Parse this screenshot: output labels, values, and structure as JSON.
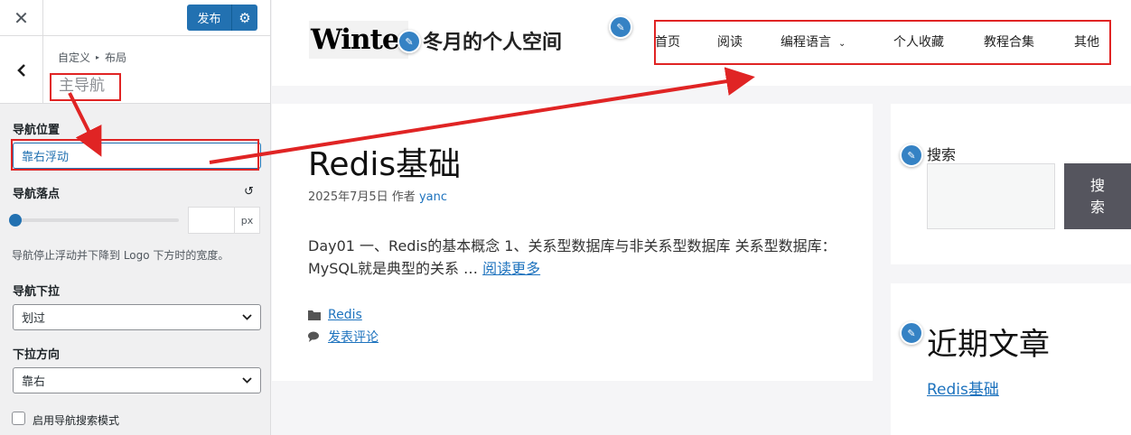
{
  "customizer": {
    "close_icon": "✕",
    "publish_label": "发布",
    "publish_gear_icon": "⚙",
    "back_icon": "‹",
    "breadcrumb": [
      "自定义",
      "布局"
    ],
    "breadcrumb_sep": "▸",
    "section_title": "主导航",
    "nav_position": {
      "label": "导航位置",
      "value": "靠右浮动"
    },
    "nav_dropoff": {
      "label": "导航落点",
      "reset_icon": "↺",
      "slider_fraction": 0,
      "value": "",
      "unit": "px"
    },
    "nav_help": "导航停止浮动并下降到 Logo 下方时的宽度。",
    "nav_dropdown": {
      "label": "导航下拉",
      "value": "划过"
    },
    "dropdown_direction": {
      "label": "下拉方向",
      "value": "靠右"
    },
    "search_mode": {
      "label": "启用导航搜索模式",
      "checked": false
    }
  },
  "preview": {
    "logo_text": "Winte",
    "site_title": "冬月的个人空间",
    "nav": [
      "首页",
      "阅读",
      "编程语言",
      "个人收藏",
      "教程合集",
      "其他"
    ],
    "nav_dropdown_icon": "⌄",
    "post": {
      "title": "Redis基础",
      "date": "2025年7月5日",
      "author_prefix": "作者",
      "author": "yanc",
      "excerpt": "Day01 一、Redis的基本概念 1、关系型数据库与非关系型数据库 关系型数据库：MySQL就是典型的关系 …",
      "read_more": "阅读更多",
      "category": "Redis",
      "comment": "发表评论"
    },
    "search_widget": {
      "label": "搜索",
      "button": "搜索"
    },
    "recent_widget": {
      "title": "近期文章",
      "link": "Redis基础"
    },
    "edit_icon": "✎"
  },
  "colors": {
    "accent": "#2271b1",
    "annotation": "#e02424",
    "link": "#1e73be"
  }
}
